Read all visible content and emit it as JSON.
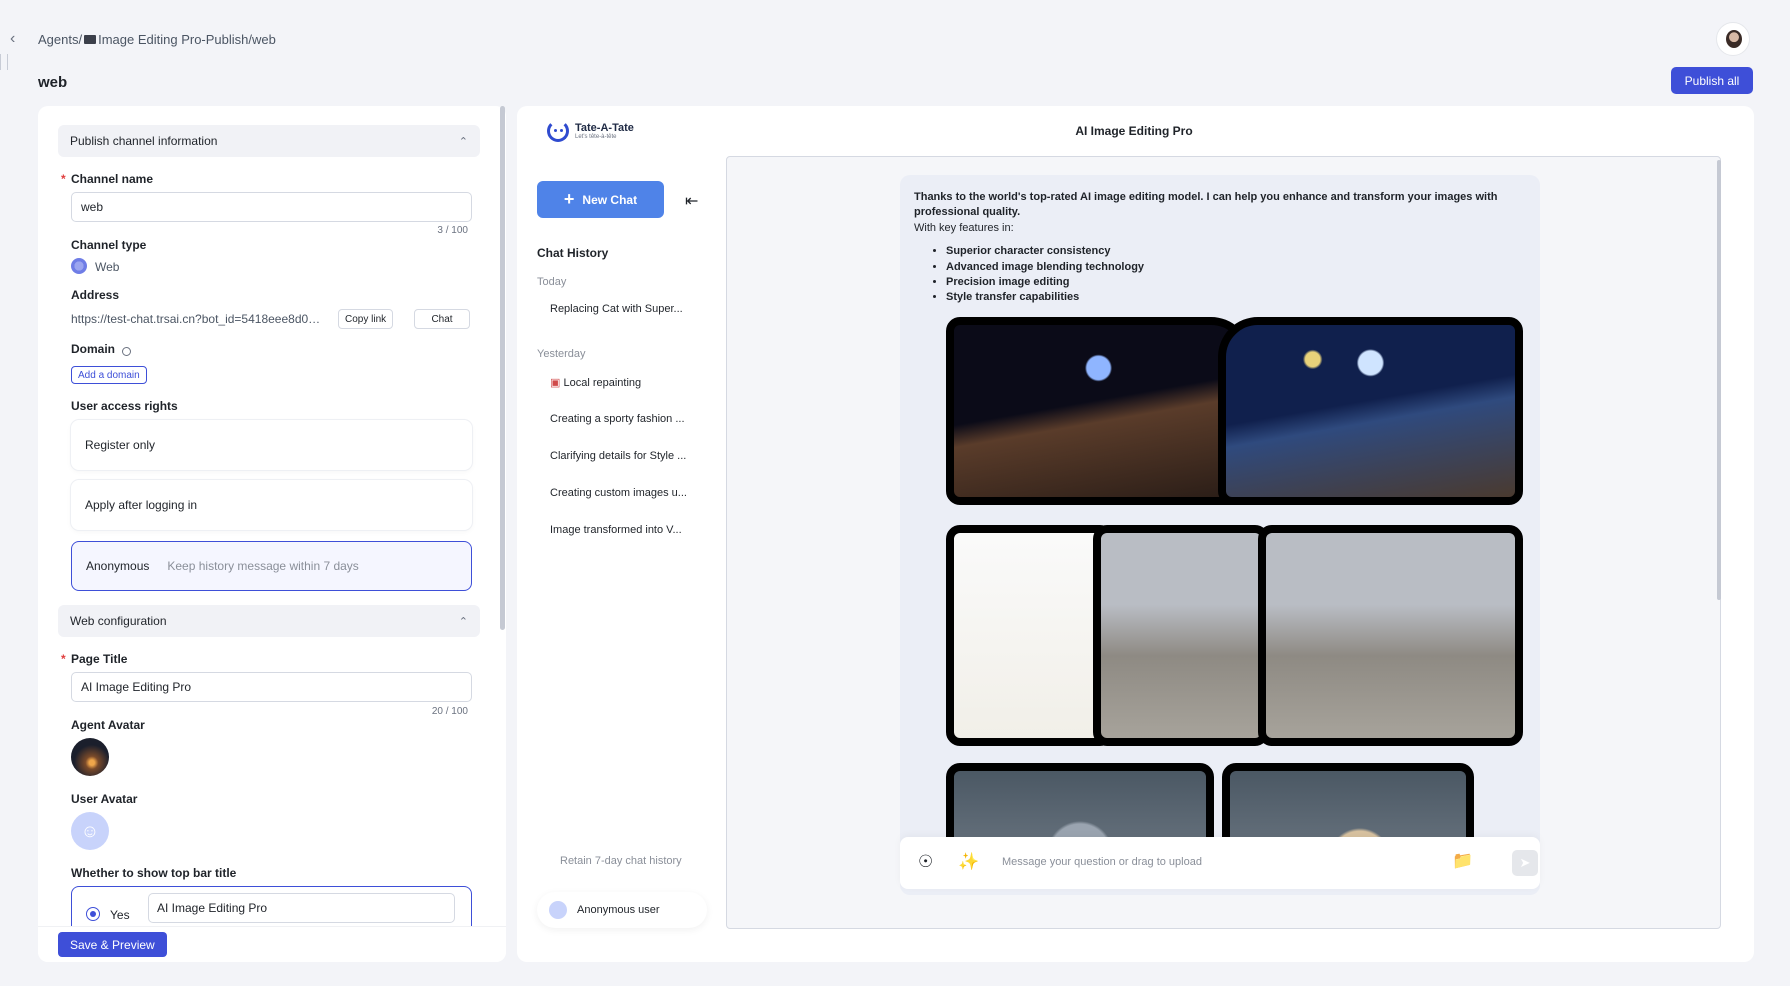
{
  "header": {
    "breadcrumb_prefix": "Agents/",
    "breadcrumb_rest": "Image Editing Pro-Publish/web",
    "page_title": "web",
    "publish_all": "Publish all"
  },
  "publish_channel": {
    "section_title": "Publish channel information",
    "channel_name_label": "Channel name",
    "channel_name_value": "web",
    "channel_name_count": "3 / 100",
    "channel_type_label": "Channel type",
    "channel_type_value": "Web",
    "address_label": "Address",
    "address_value": "https://test-chat.trsai.cn?bot_id=5418eee8d0…",
    "copy_link": "Copy link",
    "chat_button": "Chat",
    "domain_label": "Domain",
    "add_domain": "Add a domain",
    "access_label": "User access rights",
    "access_options": [
      {
        "label": "Register only",
        "sub": ""
      },
      {
        "label": "Apply after logging in",
        "sub": ""
      },
      {
        "label": "Anonymous",
        "sub": "Keep history message within 7 days"
      }
    ]
  },
  "web_config": {
    "section_title": "Web configuration",
    "page_title_label": "Page Title",
    "page_title_value": "AI Image Editing Pro",
    "page_title_count": "20 / 100",
    "agent_avatar_label": "Agent Avatar",
    "user_avatar_label": "User Avatar",
    "topbar_title_label": "Whether to show top bar title",
    "yes_label": "Yes",
    "topbar_title_value": "AI Image Editing Pro"
  },
  "footer": {
    "save_preview": "Save & Preview"
  },
  "preview": {
    "logo_name": "Tate-A-Tate",
    "logo_tag": "Let's tête-à-tête",
    "title": "AI Image Editing Pro",
    "new_chat": "New Chat",
    "history_title": "Chat History",
    "group_today": "Today",
    "group_yesterday": "Yesterday",
    "today_items": [
      "Replacing Cat with Super..."
    ],
    "yesterday_items": [
      "Local repainting",
      "Creating a sporty fashion ...",
      "Clarifying details for Style ...",
      "Creating custom images u...",
      "Image transformed into V..."
    ],
    "retain_note": "Retain 7-day chat history",
    "anon_user": "Anonymous user",
    "message": {
      "intro": "Thanks to the world's top-rated AI image editing model. I can help you enhance and transform your images with professional quality.",
      "features_lead": "With key features in:",
      "features": [
        "Superior character consistency",
        "Advanced image blending technology",
        "Precision image editing",
        "Style transfer capabilities"
      ]
    },
    "input_placeholder": "Message your question or drag to upload"
  },
  "icons": {
    "back": "chevron-left-icon",
    "collapse": "sidebar-collapse-icon",
    "bulb": "lightbulb-icon",
    "wand": "magic-wand-icon",
    "folder": "folder-upload-icon",
    "send": "send-icon"
  },
  "colors": {
    "accent": "#3e4fd8",
    "new_chat": "#4f83e8"
  }
}
